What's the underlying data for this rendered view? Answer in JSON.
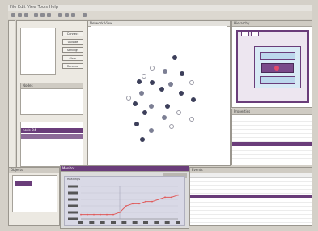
{
  "window": {
    "title": "File  Edit  View  Tools  Help"
  },
  "colors": {
    "accent": "#6a3d7a",
    "series": "#e05a5a",
    "chart_panel": "#d9d9e6"
  },
  "left_panel": {
    "buttons": [
      "Connect",
      "Update",
      "Settings",
      "Clear",
      "Rename"
    ],
    "list_header": "Nodes",
    "selected_label": "node-04"
  },
  "graph": {
    "title": "Network View"
  },
  "hierarchy": {
    "title": "Hierarchy"
  },
  "props": {
    "title": "Properties"
  },
  "chart": {
    "title": "Monitor",
    "subtitle": "Readings"
  },
  "bottom_left": {
    "title": "Objects"
  },
  "log": {
    "title": "Events"
  },
  "chart_data": {
    "type": "line",
    "series": [
      {
        "values": [
          2,
          2,
          2,
          2,
          2,
          2,
          3,
          6,
          7,
          7,
          8,
          8,
          9,
          10,
          10,
          11
        ]
      }
    ],
    "ylim": [
      0,
      15
    ],
    "grid": true
  }
}
